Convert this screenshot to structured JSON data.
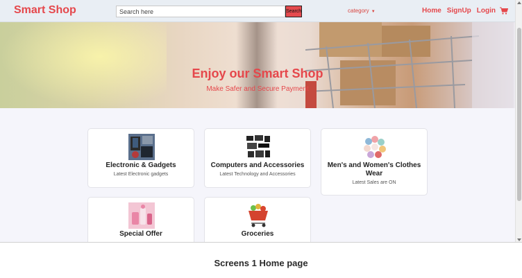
{
  "navbar": {
    "brand": "Smart Shop",
    "search_placeholder": "Search here",
    "search_button": "Search",
    "category_label": "category",
    "links": [
      "Home",
      "SignUp",
      "Login"
    ]
  },
  "hero": {
    "title": "Enjoy our Smart Shop",
    "subtitle": "Make Safer and Secure Payment"
  },
  "cards": [
    {
      "title": "Electronic & Gadgets",
      "subtitle": "Latest Electronic gadgets"
    },
    {
      "title": "Computers and Accessories",
      "subtitle": "Latest Technology and Accessories"
    },
    {
      "title": "Men's and Women's Clothes Wear",
      "subtitle": "Latest Sales are ON"
    },
    {
      "title": "Special Offer",
      "subtitle": ""
    },
    {
      "title": "Groceries",
      "subtitle": ""
    }
  ],
  "caption": "Screens 1 Home page",
  "colors": {
    "brand": "#e5474b",
    "navbar_bg": "#e9eef4",
    "page_bg": "#f5f5fb"
  }
}
